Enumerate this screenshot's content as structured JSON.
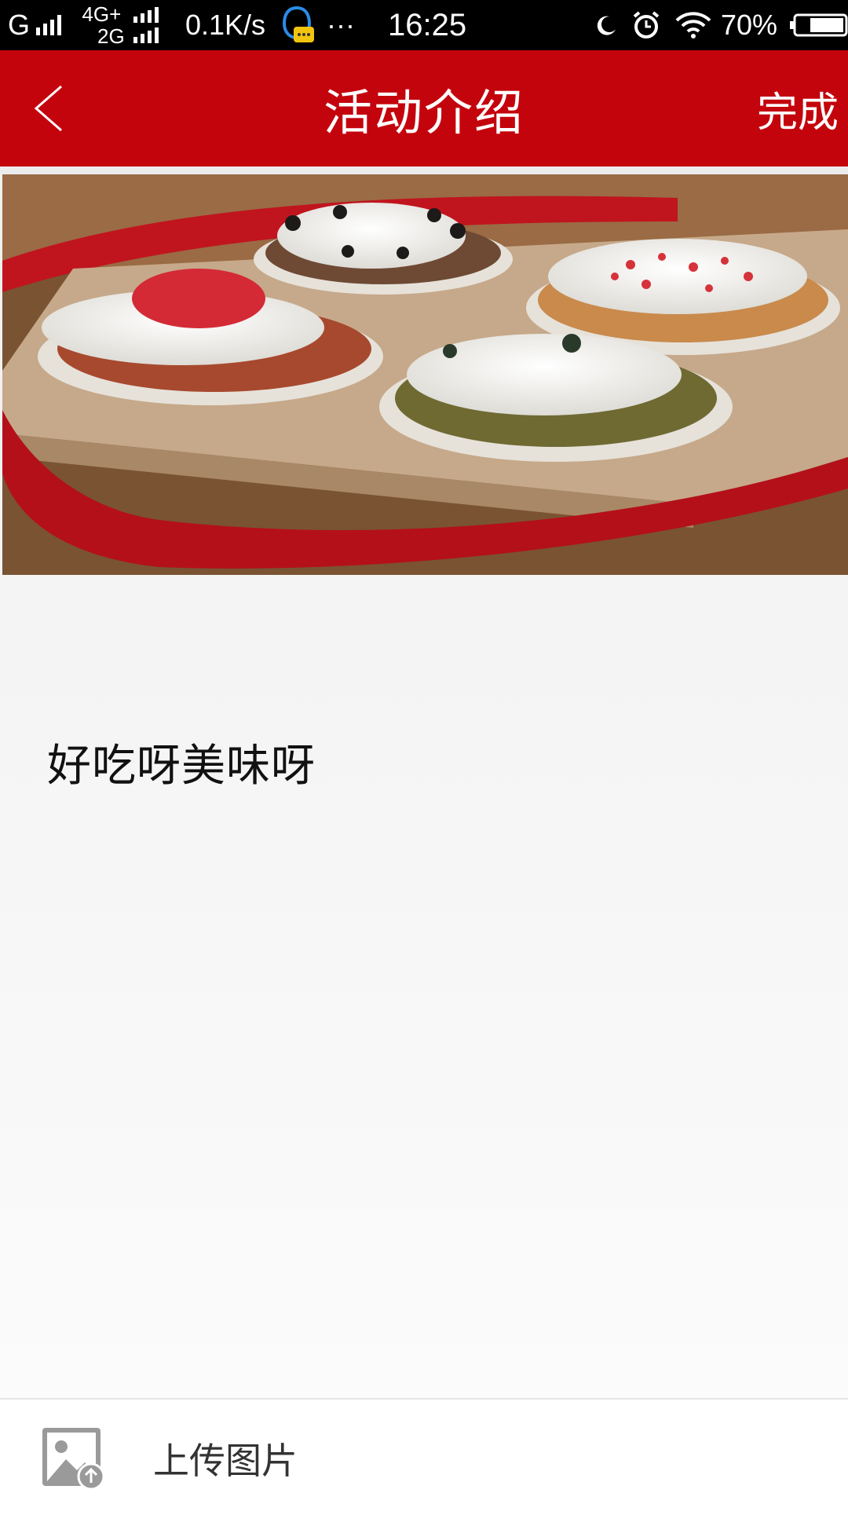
{
  "status_bar": {
    "carrier1": "G",
    "network_top": "4G+",
    "network_bottom": "2G",
    "speed": "0.1K/s",
    "more": "···",
    "time": "16:25",
    "battery": "70%"
  },
  "nav": {
    "title": "活动介绍",
    "done_label": "完成",
    "back_icon": "chevron-left-icon"
  },
  "content": {
    "image_name": "cupcakes-photo",
    "intro_text": "好吃呀美味呀"
  },
  "bottom": {
    "upload_label": "上传图片",
    "upload_icon": "image-upload-icon"
  },
  "colors": {
    "nav_background": "#c4040c",
    "status_background": "#000000"
  }
}
